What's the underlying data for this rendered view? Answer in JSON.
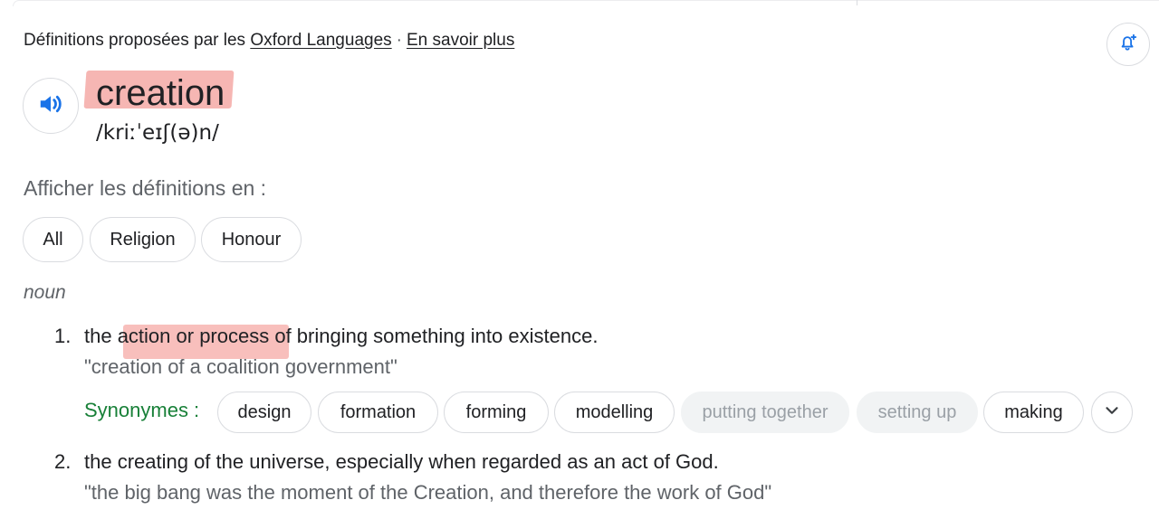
{
  "source": {
    "prefix": "Définitions proposées par les",
    "provider_link": "Oxford Languages",
    "separator": "·",
    "learn_more_link": "En savoir plus"
  },
  "bell_button": {
    "icon": "bell-plus-icon"
  },
  "speaker_button": {
    "icon": "volume-icon"
  },
  "entry": {
    "word": "creation",
    "phonetic": "/kriːˈeɪʃ(ə)n/"
  },
  "filters": {
    "label": "Afficher les définitions en :",
    "chips": [
      "All",
      "Religion",
      "Honour"
    ]
  },
  "part_of_speech": "noun",
  "definitions": [
    {
      "number": "1.",
      "text": "the action or process of bringing something into existence.",
      "example": "\"creation of a coalition government\"",
      "synonyms_label": "Synonymes :",
      "synonyms": [
        "design",
        "formation",
        "forming",
        "modelling",
        "putting together",
        "setting up",
        "making"
      ]
    },
    {
      "number": "2.",
      "text": "the creating of the universe, especially when regarded as an act of God.",
      "example": "\"the big bang was the moment of the Creation, and therefore the work of God\""
    }
  ],
  "colors": {
    "highlight": "#f5a9a6",
    "speaker_blue": "#1a73e8",
    "synonym_green": "#188038",
    "muted": "#5f6368"
  }
}
